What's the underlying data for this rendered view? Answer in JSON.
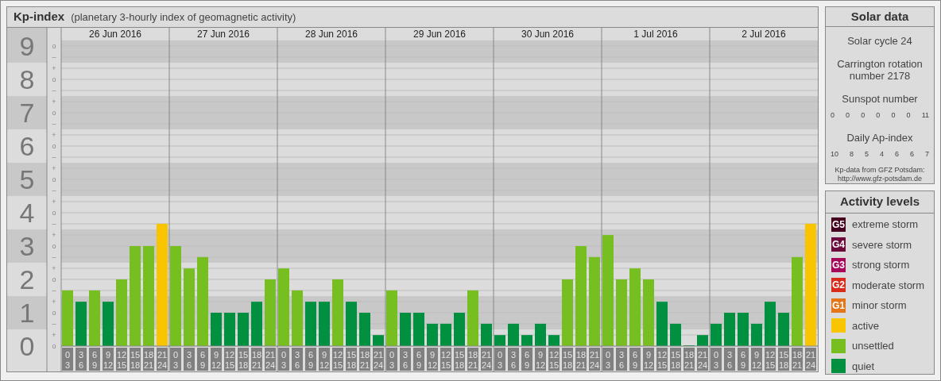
{
  "title": {
    "name": "Kp-index",
    "subtitle": "(planetary 3-hourly index of geomagnetic activity)"
  },
  "scale": [
    {
      "marks": [
        "o",
        "–"
      ]
    },
    {
      "marks": [
        "+",
        "o",
        "–"
      ]
    },
    {
      "marks": [
        "+",
        "o",
        "–"
      ]
    },
    {
      "marks": [
        "+",
        "o",
        "–"
      ]
    },
    {
      "marks": [
        "+",
        "o",
        "–"
      ]
    },
    {
      "marks": [
        "+",
        "o",
        "–"
      ]
    },
    {
      "marks": [
        "+",
        "o",
        "–"
      ]
    },
    {
      "marks": [
        "+",
        "o",
        "–"
      ]
    },
    {
      "marks": [
        "+",
        "o",
        "–"
      ]
    },
    {
      "marks": [
        "+",
        "o"
      ]
    }
  ],
  "days": [
    {
      "date": "26 Jun 2016",
      "slots": [
        {
          "from": "0",
          "to": "3"
        },
        {
          "from": "3",
          "to": "6"
        },
        {
          "from": "6",
          "to": "9"
        },
        {
          "from": "9",
          "to": "12"
        },
        {
          "from": "12",
          "to": "15"
        },
        {
          "from": "15",
          "to": "18"
        },
        {
          "from": "18",
          "to": "21"
        },
        {
          "from": "21",
          "to": "24"
        }
      ]
    },
    {
      "date": "27 Jun 2016",
      "slots": [
        {
          "from": "0",
          "to": "3"
        },
        {
          "from": "3",
          "to": "6"
        },
        {
          "from": "6",
          "to": "9"
        },
        {
          "from": "9",
          "to": "12"
        },
        {
          "from": "12",
          "to": "15"
        },
        {
          "from": "15",
          "to": "18"
        },
        {
          "from": "18",
          "to": "21"
        },
        {
          "from": "21",
          "to": "24"
        }
      ]
    },
    {
      "date": "28 Jun 2016",
      "slots": [
        {
          "from": "0",
          "to": "3"
        },
        {
          "from": "3",
          "to": "6"
        },
        {
          "from": "6",
          "to": "9"
        },
        {
          "from": "9",
          "to": "12"
        },
        {
          "from": "12",
          "to": "15"
        },
        {
          "from": "15",
          "to": "18"
        },
        {
          "from": "18",
          "to": "21"
        },
        {
          "from": "21",
          "to": "24"
        }
      ]
    },
    {
      "date": "29 Jun 2016",
      "slots": [
        {
          "from": "0",
          "to": "3"
        },
        {
          "from": "3",
          "to": "6"
        },
        {
          "from": "6",
          "to": "9"
        },
        {
          "from": "9",
          "to": "12"
        },
        {
          "from": "12",
          "to": "15"
        },
        {
          "from": "15",
          "to": "18"
        },
        {
          "from": "18",
          "to": "21"
        },
        {
          "from": "21",
          "to": "24"
        }
      ]
    },
    {
      "date": "30 Jun 2016",
      "slots": [
        {
          "from": "0",
          "to": "3"
        },
        {
          "from": "3",
          "to": "6"
        },
        {
          "from": "6",
          "to": "9"
        },
        {
          "from": "9",
          "to": "12"
        },
        {
          "from": "12",
          "to": "15"
        },
        {
          "from": "15",
          "to": "18"
        },
        {
          "from": "18",
          "to": "21"
        },
        {
          "from": "21",
          "to": "24"
        }
      ]
    },
    {
      "date": "1 Jul 2016",
      "slots": [
        {
          "from": "0",
          "to": "3"
        },
        {
          "from": "3",
          "to": "6"
        },
        {
          "from": "6",
          "to": "9"
        },
        {
          "from": "9",
          "to": "12"
        },
        {
          "from": "12",
          "to": "15"
        },
        {
          "from": "15",
          "to": "18"
        },
        {
          "from": "18",
          "to": "21"
        },
        {
          "from": "21",
          "to": "24"
        }
      ]
    },
    {
      "date": "2 Jul 2016",
      "slots": [
        {
          "from": "0",
          "to": "3"
        },
        {
          "from": "3",
          "to": "6"
        },
        {
          "from": "6",
          "to": "9"
        },
        {
          "from": "9",
          "to": "12"
        },
        {
          "from": "12",
          "to": "15"
        },
        {
          "from": "15",
          "to": "18"
        },
        {
          "from": "18",
          "to": "21"
        },
        {
          "from": "21",
          "to": "24"
        }
      ]
    }
  ],
  "chart_data": {
    "type": "bar",
    "grid": true,
    "ylim": [
      0,
      9.17
    ],
    "yticks": [
      0,
      1,
      2,
      3,
      4,
      5,
      6,
      7,
      8,
      9
    ],
    "categories": [
      null,
      null,
      null,
      null,
      null,
      null,
      null,
      null,
      null,
      null,
      null,
      null,
      null,
      null,
      null,
      null,
      null,
      null,
      null,
      null,
      null,
      null,
      null,
      null,
      null,
      null,
      null,
      null,
      null,
      null,
      null,
      null,
      null,
      null,
      null,
      null,
      null,
      null,
      null,
      null,
      null,
      null,
      null,
      null,
      null,
      null,
      null,
      null,
      null,
      null,
      null,
      null,
      null,
      null,
      null,
      null
    ],
    "values": [
      1.67,
      1.33,
      1.67,
      1.33,
      2,
      3,
      3,
      3.67,
      3,
      2.33,
      2.67,
      1,
      1,
      1,
      1.33,
      2,
      2.33,
      1.67,
      1.33,
      1.33,
      2,
      1.33,
      1,
      0.33,
      1.67,
      1,
      1,
      0.67,
      0.67,
      1,
      1.67,
      0.67,
      0.33,
      0.67,
      0.33,
      0.67,
      0.33,
      2,
      3,
      2.67,
      3.33,
      2,
      2.33,
      2,
      1.33,
      0.67,
      0,
      0.33,
      0.67,
      1,
      1,
      0.67,
      1.33,
      1,
      2.67,
      3.67
    ]
  },
  "solar": {
    "title": "Solar data",
    "cycle": "Solar cycle 24",
    "rotation": "Carrington rotation number 2178",
    "sunspot_title": "Sunspot number",
    "sunspots": [
      "0",
      "0",
      "0",
      "0",
      "0",
      "0",
      "11"
    ],
    "ap_title": "Daily Ap-index",
    "ap": [
      "10",
      "8",
      "5",
      "4",
      "6",
      "6",
      "7"
    ],
    "source": "Kp-data from GFZ Potsdam:",
    "source_link": "http://www.gfz-potsdam.de"
  },
  "legend": {
    "title": "Activity levels",
    "items": [
      {
        "badge": "G5",
        "label": "extreme storm",
        "color": "#46001f"
      },
      {
        "badge": "G4",
        "label": "severe storm",
        "color": "#6c0a3c"
      },
      {
        "badge": "G3",
        "label": "strong storm",
        "color": "#a6085a"
      },
      {
        "badge": "G2",
        "label": "moderate storm",
        "color": "#d82b1b"
      },
      {
        "badge": "G1",
        "label": "minor storm",
        "color": "#e4761a"
      },
      {
        "label": "active",
        "color": "#f9c400"
      },
      {
        "label": "unsettled",
        "color": "#77bf20"
      },
      {
        "label": "quiet",
        "color": "#00903f"
      }
    ]
  }
}
